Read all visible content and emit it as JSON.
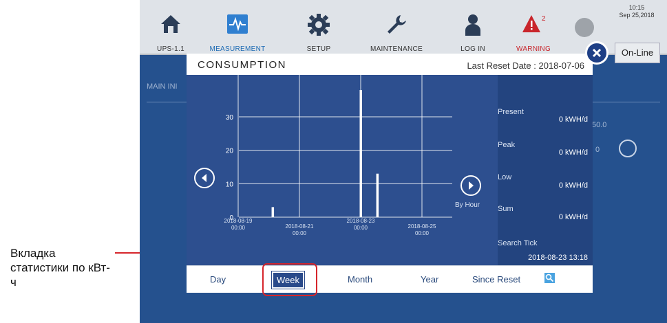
{
  "annotation": {
    "text": "Вкладка статистики по кВт-ч"
  },
  "topbar": {
    "items": [
      {
        "label": "UPS-1.1",
        "icon": "home-icon"
      },
      {
        "label": "MEASUREMENT",
        "icon": "waveform-icon"
      },
      {
        "label": "SETUP",
        "icon": "gear-icon"
      },
      {
        "label": "MAINTENANCE",
        "icon": "wrench-icon"
      },
      {
        "label": "LOG IN",
        "icon": "user-icon"
      },
      {
        "label": "WARNING",
        "icon": "warning-icon",
        "badge": "2"
      }
    ],
    "clock_time": "10:15",
    "clock_date": "Sep 25,2018",
    "status": "On-Line"
  },
  "background": {
    "section": "MAIN INI",
    "values": [
      "50.0",
      "0"
    ]
  },
  "popup": {
    "title": "CONSUMPTION",
    "last_reset": "Last Reset Date : 2018-07-06",
    "by_hour": "By Hour",
    "info": [
      {
        "label": "Present",
        "value": "0  kWH/d"
      },
      {
        "label": "Peak",
        "value": "0  kWH/d"
      },
      {
        "label": "Low",
        "value": "0  kWH/d"
      },
      {
        "label": "Sum",
        "value": "0  kWH/d"
      }
    ],
    "search_tick_label": "Search Tick",
    "search_tick_value": "2018-08-23 13:18",
    "tabs": [
      "Day",
      "Week",
      "Month",
      "Year",
      "Since Reset"
    ],
    "active_tab": "Week"
  },
  "chart_data": {
    "type": "bar",
    "x_ticks": [
      {
        "label": [
          "2018-08-19",
          "00:00"
        ]
      },
      {
        "label": [
          "2018-08-21",
          "00:00"
        ]
      },
      {
        "label": [
          "2018-08-23",
          "00:00"
        ]
      },
      {
        "label": [
          "2018-08-25",
          "00:00"
        ]
      }
    ],
    "y_ticks": [
      "0",
      "10",
      "20",
      "30"
    ],
    "ylim": [
      0,
      38
    ],
    "bars": [
      {
        "x": "2018-08-20 03:00",
        "value": 3
      },
      {
        "x": "2018-08-23 00:00",
        "value": 38
      },
      {
        "x": "2018-08-23 13:00",
        "value": 13
      }
    ],
    "grid": true
  },
  "colors": {
    "accent": "#2a4a8a",
    "warning": "#c9252b",
    "highlight": "#d6252b"
  }
}
